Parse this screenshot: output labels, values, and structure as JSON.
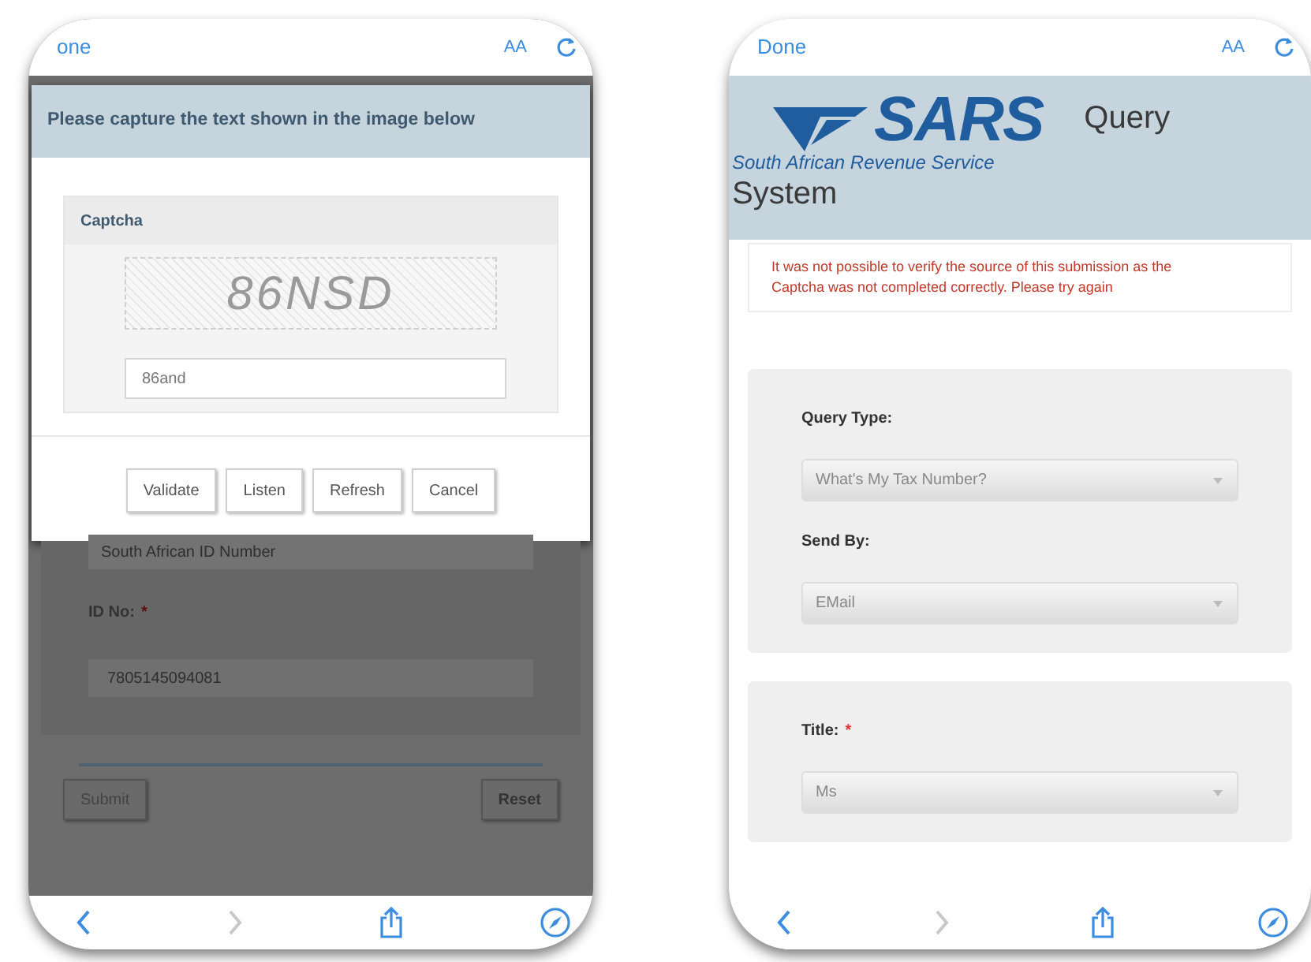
{
  "left_screen": {
    "browser_bar": {
      "done": "one",
      "text_size": "AA"
    },
    "dialog": {
      "title": "Please capture the text shown in the image below",
      "panel_title": "Captcha",
      "captcha_text": "86NSD",
      "input_value": "86and",
      "buttons": [
        "Validate",
        "Listen",
        "Refresh",
        "Cancel"
      ]
    },
    "page": {
      "id_type_value": "South African ID Number",
      "id_label": "ID No:",
      "required_mark": "*",
      "id_value": "7805145094081",
      "buttons": [
        "Submit",
        "Reset"
      ]
    }
  },
  "right_screen": {
    "browser_bar": {
      "done": "Done",
      "text_size": "AA"
    },
    "header": {
      "logo_text": "SARS",
      "logo_tagline": "South African Revenue Service",
      "title_part_1": "Query",
      "title_part_2": "System"
    },
    "error_message": "It was not possible to verify the source of this submission as the Captcha was not completed correctly. Please try again",
    "sections": [
      {
        "fields": [
          {
            "label": "Query Type:",
            "value": "What's My Tax Number?"
          },
          {
            "label": "Send By:",
            "value": "EMail"
          }
        ]
      },
      {
        "fields": [
          {
            "label": "Title:",
            "required_mark": "*",
            "value": "Ms"
          }
        ]
      }
    ]
  }
}
